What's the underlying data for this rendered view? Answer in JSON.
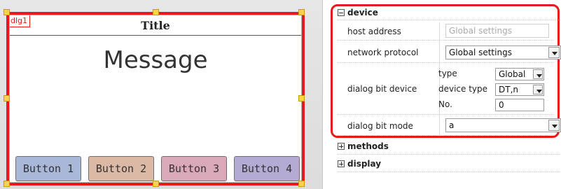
{
  "dialog": {
    "tag": "dlg1",
    "title": "Title",
    "message": "Message",
    "buttons": [
      {
        "label": "Button 1",
        "color": "#a9b8d8"
      },
      {
        "label": "Button 2",
        "color": "#dcb9a4"
      },
      {
        "label": "Button 3",
        "color": "#dba8ba"
      },
      {
        "label": "Button 4",
        "color": "#b3abd3"
      }
    ],
    "frame_color": "#e51a1a",
    "handle_color": "#ffd24a"
  },
  "properties": {
    "device_group": {
      "header": "device",
      "host_address": {
        "label": "host address",
        "value": "Global settings"
      },
      "network_protocol": {
        "label": "network protocol",
        "value": "Global settings"
      },
      "dialog_bit_device": {
        "label": "dialog bit device",
        "type_label": "type",
        "type_value": "Global",
        "device_type_label": "device type",
        "device_type_value": "DT,n",
        "no_label": "No.",
        "no_value": "0"
      },
      "dialog_bit_mode": {
        "label": "dialog bit mode",
        "value": "a"
      }
    },
    "methods_header": "methods",
    "display_header": "display"
  }
}
